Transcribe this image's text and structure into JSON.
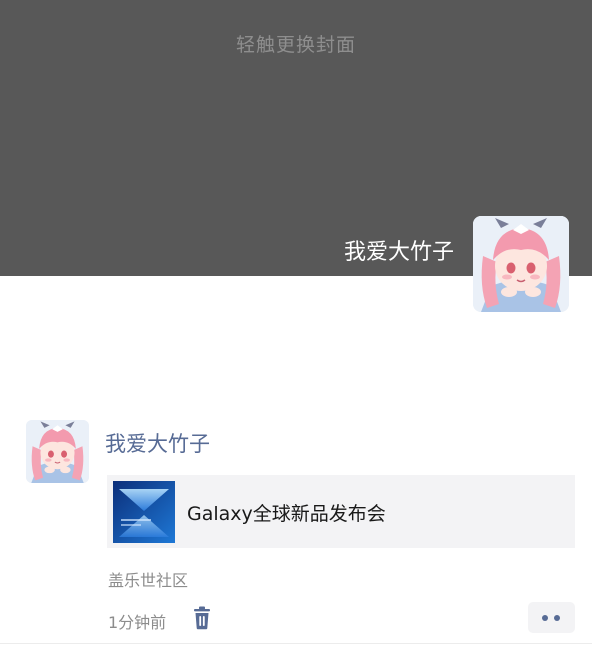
{
  "cover": {
    "hint": "轻触更换封面"
  },
  "profile": {
    "name": "我爱大竹子",
    "avatar_icon": "anime-girl-avatar"
  },
  "post": {
    "author": "我爱大竹子",
    "avatar_icon": "anime-girl-avatar",
    "share": {
      "title": "Galaxy全球新品发布会",
      "thumbnail_icon": "galaxy-event-thumbnail"
    },
    "source": "盖乐世社区",
    "time": "1分钟前",
    "delete_icon": "trash-icon",
    "more_icon": "more-dots-icon"
  },
  "colors": {
    "cover_bg": "#585858",
    "name_link": "#576b95",
    "card_bg": "#f3f3f5",
    "meta_text": "#8c8c8c"
  }
}
